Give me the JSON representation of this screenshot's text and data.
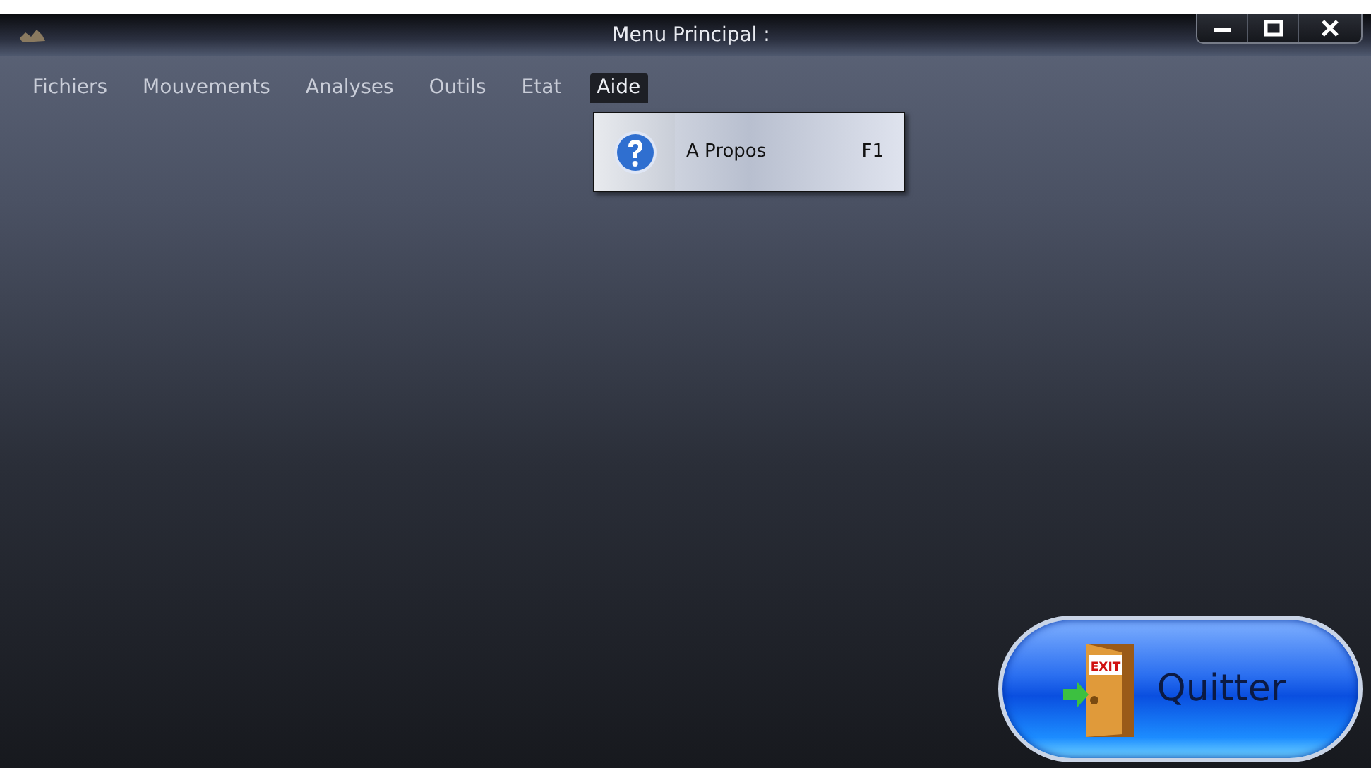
{
  "window": {
    "title": "Menu Principal :"
  },
  "menu_bar": [
    {
      "label": "Fichiers",
      "selected": false
    },
    {
      "label": "Mouvements",
      "selected": false
    },
    {
      "label": "Analyses",
      "selected": false
    },
    {
      "label": "Outils",
      "selected": false
    },
    {
      "label": "Etat",
      "selected": false
    },
    {
      "label": "Aide",
      "selected": true
    }
  ],
  "open_menu": {
    "items": [
      {
        "label": "A Propos",
        "shortcut": "F1"
      }
    ]
  },
  "exit_button": {
    "label": "Quitter",
    "door_sign": "EXIT"
  }
}
